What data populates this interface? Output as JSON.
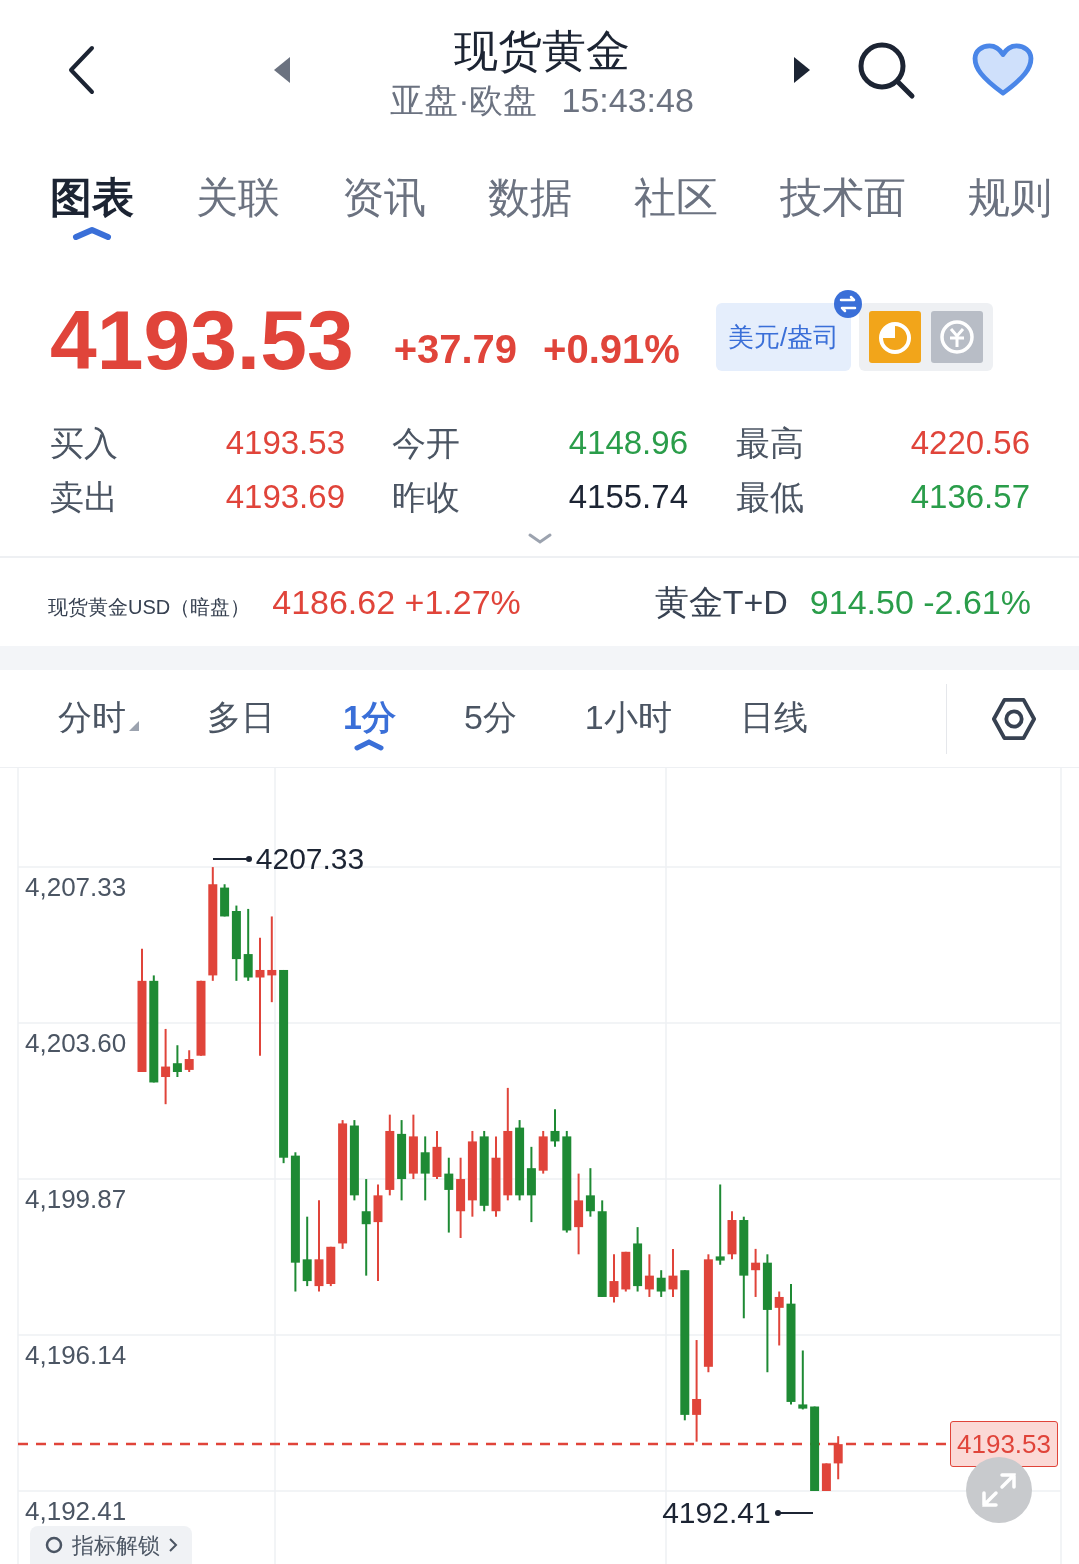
{
  "header": {
    "title": "现货黄金",
    "session": "亚盘·欧盘",
    "time": "15:43:48"
  },
  "tabs": [
    {
      "label": "图表",
      "selected": true
    },
    {
      "label": "关联",
      "selected": false
    },
    {
      "label": "资讯",
      "selected": false
    },
    {
      "label": "数据",
      "selected": false
    },
    {
      "label": "社区",
      "selected": false
    },
    {
      "label": "技术面",
      "selected": false
    },
    {
      "label": "规则",
      "selected": false
    }
  ],
  "quote": {
    "price": "4193.53",
    "change": "+37.79",
    "change_pct": "+0.91%",
    "color": "#e0443a",
    "unit_toggle": "美元/盎司"
  },
  "stats": [
    {
      "label": "买入",
      "value": "4193.53",
      "color": "#e0443a"
    },
    {
      "label": "今开",
      "value": "4148.96",
      "color": "#2a9d4a"
    },
    {
      "label": "最高",
      "value": "4220.56",
      "color": "#e0443a"
    },
    {
      "label": "卖出",
      "value": "4193.69",
      "color": "#e0443a"
    },
    {
      "label": "昨收",
      "value": "4155.74",
      "color": "#1c2433"
    },
    {
      "label": "最低",
      "value": "4136.57",
      "color": "#2a9d4a"
    }
  ],
  "related": [
    {
      "name": "现货黄金USD（暗盘）",
      "value": "4186.62 +1.27%",
      "color": "#e0443a"
    },
    {
      "name": "黄金T+D",
      "value": "914.50 -2.61%",
      "color": "#2a9d4a"
    }
  ],
  "periods": [
    {
      "label": "分时",
      "selected": false,
      "dropdown": true
    },
    {
      "label": "多日",
      "selected": false,
      "dropdown": false
    },
    {
      "label": "1分",
      "selected": true,
      "dropdown": false
    },
    {
      "label": "5分",
      "selected": false,
      "dropdown": false
    },
    {
      "label": "1小时",
      "selected": false,
      "dropdown": false
    },
    {
      "label": "日线",
      "selected": false,
      "dropdown": false
    }
  ],
  "chart": {
    "chart_data": {
      "type": "candlestick",
      "ylim": [
        4190.64,
        4209.7
      ],
      "grid": true,
      "ref_lines": [
        {
          "axis": "y",
          "value": 4193.53,
          "label": "4193.53"
        }
      ],
      "yticks": [
        {
          "value": 4207.33,
          "label": "4,207.33"
        },
        {
          "value": 4203.6,
          "label": "4,203.60"
        },
        {
          "value": 4199.87,
          "label": "4,199.87"
        },
        {
          "value": 4196.14,
          "label": "4,196.14"
        },
        {
          "value": 4192.41,
          "label": "4,192.41"
        }
      ],
      "ohlc": [
        [
          4202.43,
          4205.38,
          4202.43,
          4204.61
        ],
        [
          4204.61,
          4204.74,
          4202.18,
          4202.18
        ],
        [
          4202.31,
          4203.46,
          4201.66,
          4202.56
        ],
        [
          4202.64,
          4203.07,
          4202.31,
          4202.43
        ],
        [
          4202.48,
          4202.95,
          4202.43,
          4202.74
        ],
        [
          4202.82,
          4204.61,
          4202.82,
          4204.61
        ],
        [
          4204.74,
          4207.33,
          4204.61,
          4206.92
        ],
        [
          4206.84,
          4206.92,
          4206.15,
          4206.15
        ],
        [
          4206.28,
          4206.41,
          4204.61,
          4205.13
        ],
        [
          4205.25,
          4206.33,
          4204.61,
          4204.69
        ],
        [
          4204.69,
          4205.64,
          4202.82,
          4204.87
        ],
        [
          4204.74,
          4206.15,
          4204.1,
          4204.87
        ],
        [
          4204.87,
          4204.87,
          4200.25,
          4200.38
        ],
        [
          4200.43,
          4200.51,
          4197.18,
          4197.87
        ],
        [
          4197.95,
          4198.97,
          4197.31,
          4197.43
        ],
        [
          4197.31,
          4199.36,
          4197.18,
          4197.95
        ],
        [
          4197.36,
          4198.25,
          4197.31,
          4198.25
        ],
        [
          4198.33,
          4201.28,
          4198.2,
          4201.2
        ],
        [
          4201.15,
          4201.28,
          4199.36,
          4199.48
        ],
        [
          4199.1,
          4199.87,
          4197.56,
          4198.79
        ],
        [
          4198.84,
          4199.74,
          4197.43,
          4199.48
        ],
        [
          4199.61,
          4201.41,
          4199.48,
          4201.02
        ],
        [
          4200.95,
          4201.28,
          4199.36,
          4199.87
        ],
        [
          4200.0,
          4201.41,
          4199.87,
          4200.89
        ],
        [
          4200.51,
          4200.89,
          4199.36,
          4200.0
        ],
        [
          4199.92,
          4201.02,
          4199.87,
          4200.64
        ],
        [
          4200.0,
          4200.38,
          4198.59,
          4199.61
        ],
        [
          4199.1,
          4200.38,
          4198.46,
          4199.87
        ],
        [
          4199.36,
          4201.02,
          4198.97,
          4200.77
        ],
        [
          4200.89,
          4201.02,
          4199.1,
          4199.23
        ],
        [
          4199.1,
          4200.89,
          4198.97,
          4200.38
        ],
        [
          4199.48,
          4202.05,
          4199.36,
          4201.02
        ],
        [
          4201.1,
          4201.28,
          4199.36,
          4199.48
        ],
        [
          4200.13,
          4200.64,
          4198.84,
          4199.48
        ],
        [
          4200.07,
          4201.02,
          4200.0,
          4200.89
        ],
        [
          4201.02,
          4201.54,
          4200.64,
          4200.77
        ],
        [
          4200.89,
          4201.02,
          4198.59,
          4198.64
        ],
        [
          4198.72,
          4200.0,
          4198.07,
          4199.36
        ],
        [
          4199.48,
          4200.13,
          4198.97,
          4199.1
        ],
        [
          4199.1,
          4199.36,
          4197.05,
          4197.05
        ],
        [
          4197.05,
          4198.07,
          4196.92,
          4197.43
        ],
        [
          4197.23,
          4198.13,
          4197.18,
          4198.13
        ],
        [
          4198.33,
          4198.72,
          4197.18,
          4197.31
        ],
        [
          4197.23,
          4198.07,
          4197.05,
          4197.56
        ],
        [
          4197.51,
          4197.69,
          4197.05,
          4197.18
        ],
        [
          4197.23,
          4198.2,
          4197.05,
          4197.56
        ],
        [
          4197.69,
          4197.69,
          4194.1,
          4194.23
        ],
        [
          4194.23,
          4196.02,
          4193.59,
          4194.61
        ],
        [
          4195.38,
          4198.07,
          4195.25,
          4197.95
        ],
        [
          4198.02,
          4199.74,
          4197.82,
          4197.92
        ],
        [
          4198.07,
          4199.1,
          4197.95,
          4198.89
        ],
        [
          4198.89,
          4198.97,
          4196.54,
          4197.56
        ],
        [
          4197.69,
          4198.2,
          4197.05,
          4197.87
        ],
        [
          4197.87,
          4198.07,
          4195.25,
          4196.74
        ],
        [
          4196.79,
          4197.18,
          4195.89,
          4197.05
        ],
        [
          4196.89,
          4197.36,
          4194.48,
          4194.54
        ],
        [
          4194.48,
          4195.77,
          4194.36,
          4194.38
        ],
        [
          4194.43,
          4194.43,
          4192.41,
          4192.41
        ],
        [
          4192.41,
          4193.07,
          4192.41,
          4193.07
        ],
        [
          4193.07,
          4193.72,
          4192.69,
          4193.53
        ]
      ]
    },
    "high_marker": "4207.33",
    "low_marker": "4192.41"
  },
  "indicator_button": "指标解锁"
}
